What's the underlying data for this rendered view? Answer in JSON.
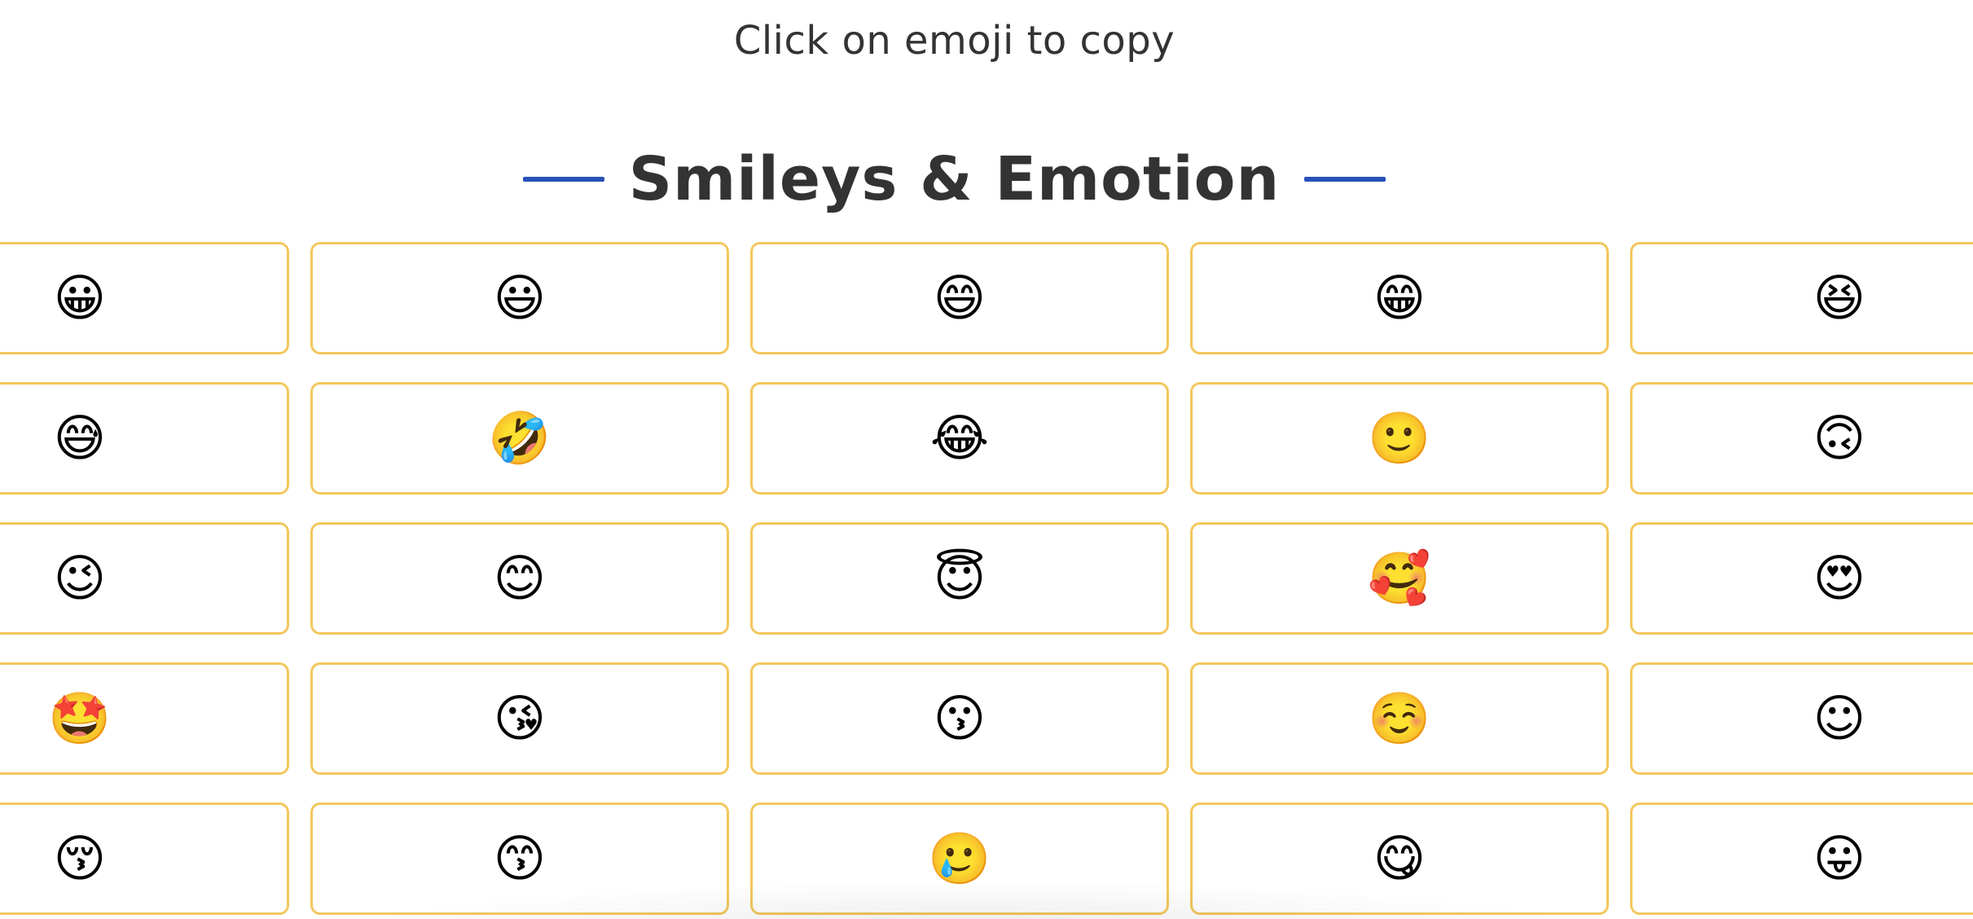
{
  "instruction": "Click on emoji to copy",
  "section": {
    "title": "Smileys & Emotion",
    "accent_color": "#2851b8",
    "tile_border_color": "#f2c75c"
  },
  "emojis": [
    {
      "char": "😀",
      "name": "grinning-face"
    },
    {
      "char": "😃",
      "name": "grinning-face-with-big-eyes"
    },
    {
      "char": "😄",
      "name": "grinning-face-with-smiling-eyes"
    },
    {
      "char": "😁",
      "name": "beaming-face-with-smiling-eyes"
    },
    {
      "char": "😆",
      "name": "grinning-squinting-face"
    },
    {
      "char": "😅",
      "name": "grinning-face-with-sweat"
    },
    {
      "char": "🤣",
      "name": "rolling-on-the-floor-laughing"
    },
    {
      "char": "😂",
      "name": "face-with-tears-of-joy"
    },
    {
      "char": "🙂",
      "name": "slightly-smiling-face"
    },
    {
      "char": "🙃",
      "name": "upside-down-face"
    },
    {
      "char": "😉",
      "name": "winking-face"
    },
    {
      "char": "😊",
      "name": "smiling-face-with-smiling-eyes"
    },
    {
      "char": "😇",
      "name": "smiling-face-with-halo"
    },
    {
      "char": "🥰",
      "name": "smiling-face-with-hearts"
    },
    {
      "char": "😍",
      "name": "smiling-face-with-heart-eyes"
    },
    {
      "char": "🤩",
      "name": "star-struck"
    },
    {
      "char": "😘",
      "name": "face-blowing-a-kiss"
    },
    {
      "char": "😗",
      "name": "kissing-face"
    },
    {
      "char": "☺️",
      "name": "smiling-face"
    },
    {
      "char": "☺",
      "name": "smiling-face-text"
    },
    {
      "char": "😚",
      "name": "kissing-face-with-closed-eyes"
    },
    {
      "char": "😙",
      "name": "kissing-face-with-smiling-eyes"
    },
    {
      "char": "🥲",
      "name": "smiling-face-with-tear"
    },
    {
      "char": "😋",
      "name": "face-savoring-food"
    },
    {
      "char": "😛",
      "name": "face-with-tongue"
    }
  ]
}
